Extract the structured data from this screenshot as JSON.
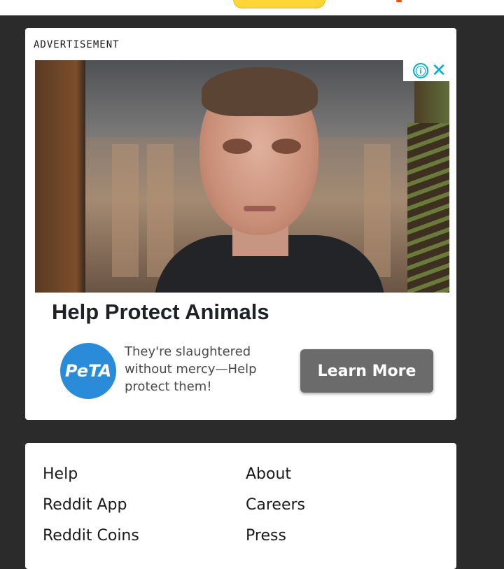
{
  "ad": {
    "label": "ADVERTISEMENT",
    "headline": "Help Protect Animals",
    "brand_logo_text": "PeTA",
    "body": "They're slaughtered without mercy—Help protect them!",
    "cta_label": "Learn More",
    "adchoices_info_symbol": "ⓘ",
    "close_symbol": "✕"
  },
  "footer": {
    "links": [
      "Help",
      "About",
      "Reddit App",
      "Careers",
      "Reddit Coins",
      "Press"
    ]
  },
  "colors": {
    "page_background": "#2b2b2b",
    "card_background": "#ffffff",
    "adchoices": "#00aecd",
    "brand_logo": "#2a8bd9",
    "cta_background": "#6b6b6b",
    "top_pill": "#ffd635"
  },
  "icons": {
    "adchoices": "info-icon",
    "close": "close-icon"
  }
}
